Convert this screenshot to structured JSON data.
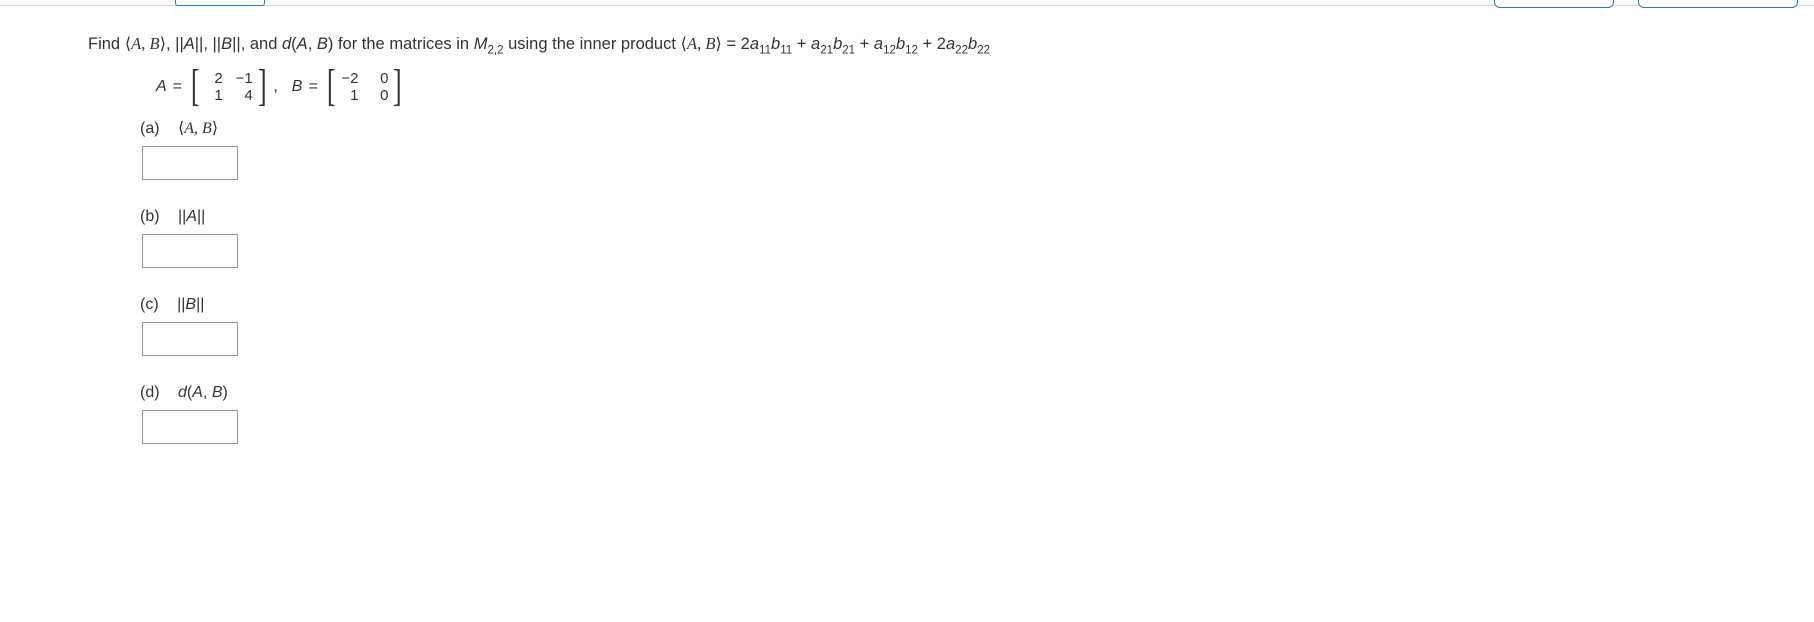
{
  "prompt": {
    "pre": "Find ",
    "ab": "⟨A, B⟩",
    "sep1": ", ",
    "normA": "||A||",
    "sep2": ", ",
    "normB": "||B||",
    "sep3": ", and ",
    "dAB": "d(A, B)",
    "mid": " for the matrices in ",
    "space": "M",
    "space_sub": "2,2",
    "using": " using the inner product ",
    "ab2": "⟨A, B⟩",
    "eq": " = ",
    "coef1": "2",
    "a11": "a",
    "s11a": "11",
    "b11": "b",
    "s11b": "11",
    "plus1": " + ",
    "a21": "a",
    "s21a": "21",
    "b21": "b",
    "s21b": "21",
    "plus2": " + ",
    "a12": "a",
    "s12a": "12",
    "b12": "b",
    "s12b": "12",
    "plus3": " + ",
    "coef4": "2",
    "a22": "a",
    "s22a": "22",
    "b22": "b",
    "s22b": "22"
  },
  "matrixA": {
    "label": "A",
    "eq": "=",
    "m11": "2",
    "m12": "−1",
    "m21": "1",
    "m22": "4"
  },
  "matrixB": {
    "label": "B",
    "eq": "=",
    "m11": "−2",
    "m12": "0",
    "m21": "1",
    "m22": "0"
  },
  "parts": {
    "a": {
      "letter": "(a)",
      "expr": "⟨A, B⟩"
    },
    "b": {
      "letter": "(b)",
      "expr": "||A||"
    },
    "c": {
      "letter": "(c)",
      "expr": "||B||"
    },
    "d": {
      "letter": "(d)",
      "expr": "d(A, B)"
    }
  }
}
